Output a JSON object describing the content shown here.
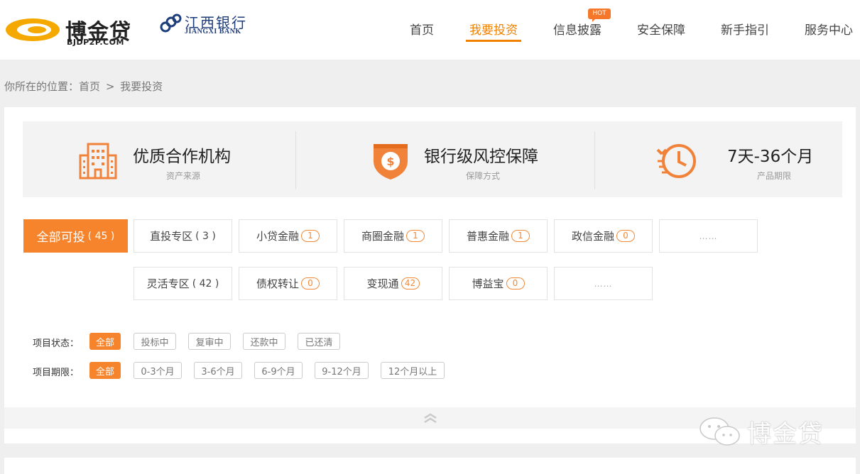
{
  "brand": {
    "logo_text": "博金贷",
    "logo_sub": "BJDP2P.COM",
    "bank_cn": "江西银行",
    "bank_en": "JIANGXI BANK",
    "accent": "#f5842c"
  },
  "nav": {
    "items": [
      "首页",
      "我要投资",
      "信息披露",
      "安全保障",
      "新手指引",
      "服务中心"
    ],
    "active": "我要投资",
    "hot_label": "HOT"
  },
  "breadcrumb": {
    "prefix": "你所在的位置：",
    "home": "首页",
    "sep": ">",
    "current": "我要投资"
  },
  "features": [
    {
      "title": "优质合作机构",
      "sub": "资产来源",
      "icon": "building-icon"
    },
    {
      "title": "银行级风控保障",
      "sub": "保障方式",
      "icon": "shield-icon"
    },
    {
      "title": "7天-36个月",
      "sub": "产品期限",
      "icon": "clock-icon"
    }
  ],
  "tabs_row1": [
    {
      "label": "全部可投",
      "count": "( 45 )",
      "active": true
    },
    {
      "label": "直投专区",
      "count": "( 3 )"
    },
    {
      "label": "小贷金融",
      "badge": "1"
    },
    {
      "label": "商圈金融",
      "badge": "1"
    },
    {
      "label": "普惠金融",
      "badge": "1"
    },
    {
      "label": "政信金融",
      "badge": "0"
    },
    {
      "label": "……"
    }
  ],
  "tabs_row2": [
    {
      "label": "灵活专区",
      "count": "( 42 )"
    },
    {
      "label": "债权转让",
      "badge": "0"
    },
    {
      "label": "变现通",
      "badge": "42"
    },
    {
      "label": "博益宝",
      "badge": "0"
    },
    {
      "label": "……"
    }
  ],
  "filters": {
    "status_label": "项目状态：",
    "status_options": [
      "全部",
      "投标中",
      "复审中",
      "还款中",
      "已还清"
    ],
    "period_label": "项目期限：",
    "period_options": [
      "全部",
      "0-3个月",
      "3-6个月",
      "6-9个月",
      "9-12个月",
      "12个月以上"
    ]
  },
  "watermark": "博金贷"
}
